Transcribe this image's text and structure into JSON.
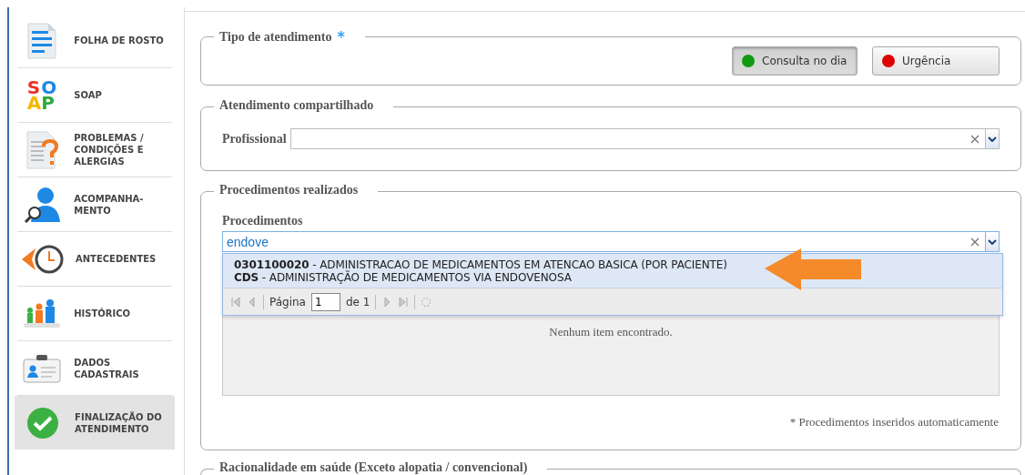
{
  "sidebar": {
    "items": [
      {
        "kind": "document",
        "label": "FOLHA DE ROSTO",
        "selected": false
      },
      {
        "kind": "soap",
        "label": "SOAP",
        "selected": false,
        "letters": [
          {
            "text": "S",
            "color": "#e8332a"
          },
          {
            "text": "O",
            "color": "#1e88e5"
          },
          {
            "text": "A",
            "color": "#f5b800"
          },
          {
            "text": "P",
            "color": "#2eaa3c"
          }
        ]
      },
      {
        "kind": "problems",
        "label": "PROBLEMAS / CONDIÇÕES E ALERGIAS",
        "selected": false
      },
      {
        "kind": "followup",
        "label": "ACOMPANHA- MENTO",
        "selected": false
      },
      {
        "kind": "clock",
        "label": "ANTECEDENTES",
        "selected": false
      },
      {
        "kind": "people",
        "label": "HISTÓRICO",
        "selected": false
      },
      {
        "kind": "card",
        "label": "DADOS CADASTRAIS",
        "selected": false
      },
      {
        "kind": "check",
        "label": "FINALIZAÇÃO DO ATENDIMENTO",
        "selected": true
      }
    ]
  },
  "tipo_atendimento": {
    "legend": "Tipo de atendimento",
    "required_mark": "*",
    "options": [
      {
        "label": "Consulta no dia",
        "color": "#119a11",
        "selected": true
      },
      {
        "label": "Urgência",
        "color": "#e00000",
        "selected": false
      }
    ]
  },
  "atendimento_compartilhado": {
    "legend": "Atendimento compartilhado",
    "field_label": "Profissional"
  },
  "procedimentos_realizados": {
    "legend": "Procedimentos realizados",
    "field_label": "Procedimentos",
    "value": "endove",
    "results": [
      "**0301100020** - ADMINISTRACAO DE MEDICAMENTOS EM ATENCAO BASICA (POR PACIENTE)",
      "**CDS** - ADMINISTRAÇÃO DE MEDICAMENTOS VIA ENDOVENOSA"
    ],
    "pager": {
      "page_label": "Página",
      "page": "1",
      "of_label": "de 1"
    },
    "empty_text": "Nenhum item encontrado.",
    "footnote": "* Procedimentos inseridos automaticamente"
  },
  "racionalidade": {
    "legend": "Racionalidade em saúde (Exceto alopatia / convencional)"
  }
}
